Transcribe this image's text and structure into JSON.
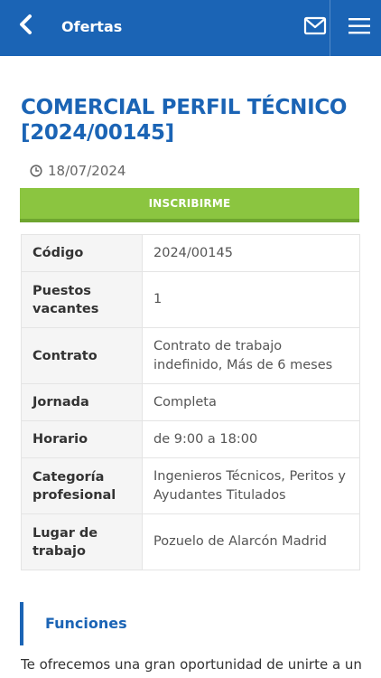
{
  "header": {
    "title": "Ofertas",
    "background": "#1b64b5"
  },
  "job": {
    "title": "COMERCIAL PERFIL TÉCNICO [2024/00145]",
    "date": "18/07/2024",
    "subscribe_label": "INSCRIBIRME",
    "accent_green": "#8bc540"
  },
  "details": {
    "rows": [
      {
        "key": "Código",
        "value": "2024/00145"
      },
      {
        "key": "Puestos vacantes",
        "value": "1"
      },
      {
        "key": "Contrato",
        "value": "Contrato de trabajo indefinido, Más de 6 meses"
      },
      {
        "key": "Jornada",
        "value": "Completa"
      },
      {
        "key": "Horario",
        "value": "de 9:00 a 18:00"
      },
      {
        "key": "Categoría profesional",
        "value": "Ingenieros Técnicos, Peritos y Ayudantes Titulados"
      },
      {
        "key": "Lugar de trabajo",
        "value": "Pozuelo de Alarcón Madrid"
      }
    ]
  },
  "functions": {
    "heading": "Funciones",
    "text": "Te ofrecemos una gran oportunidad de unirte a un"
  }
}
